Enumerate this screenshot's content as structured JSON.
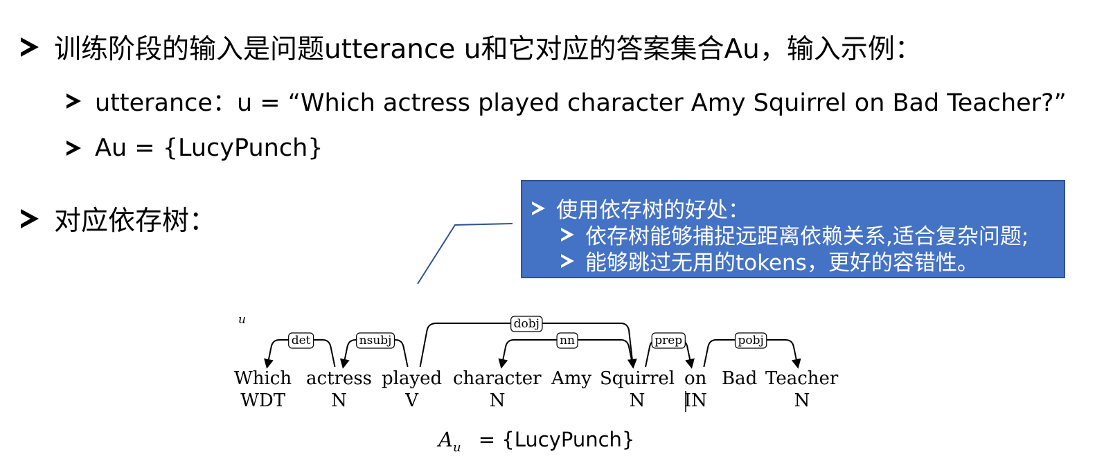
{
  "bullets": {
    "b1": "训练阶段的输入是问题utterance u和它对应的答案集合Au，输入示例：",
    "b1a": "utterance：u = “Which actress played character Amy Squirrel on Bad Teacher?”",
    "b1b": "Au = {LucyPunch}",
    "b2": "对应依存树："
  },
  "callout": {
    "title": "使用依存树的好处：",
    "items": [
      "依存树能够捕捉远距离依赖关系,适合复杂问题;",
      "能够跳过无用的tokens，更好的容错性。"
    ]
  },
  "tree": {
    "label": "u",
    "tokens": [
      "Which",
      "actress",
      "played",
      "character",
      "Amy",
      "Squirrel",
      "on",
      "Bad",
      "Teacher"
    ],
    "pos": [
      "WDT",
      "N",
      "V",
      "N",
      "",
      "N",
      "IN",
      "",
      "N"
    ],
    "arcs": [
      {
        "label": "det",
        "head": "actress",
        "dep": "Which"
      },
      {
        "label": "nsubj",
        "head": "played",
        "dep": "actress"
      },
      {
        "label": "dobj",
        "head": "played",
        "dep": "Squirrel"
      },
      {
        "label": "nn",
        "head": "Squirrel",
        "dep": "character"
      },
      {
        "label": "prep",
        "head": "Squirrel",
        "dep": "on"
      },
      {
        "label": "pobj",
        "head": "on",
        "dep": "Teacher"
      }
    ],
    "answer": {
      "symbol": "A",
      "subscript": "u",
      "text": "= {LucyPunch}"
    }
  }
}
